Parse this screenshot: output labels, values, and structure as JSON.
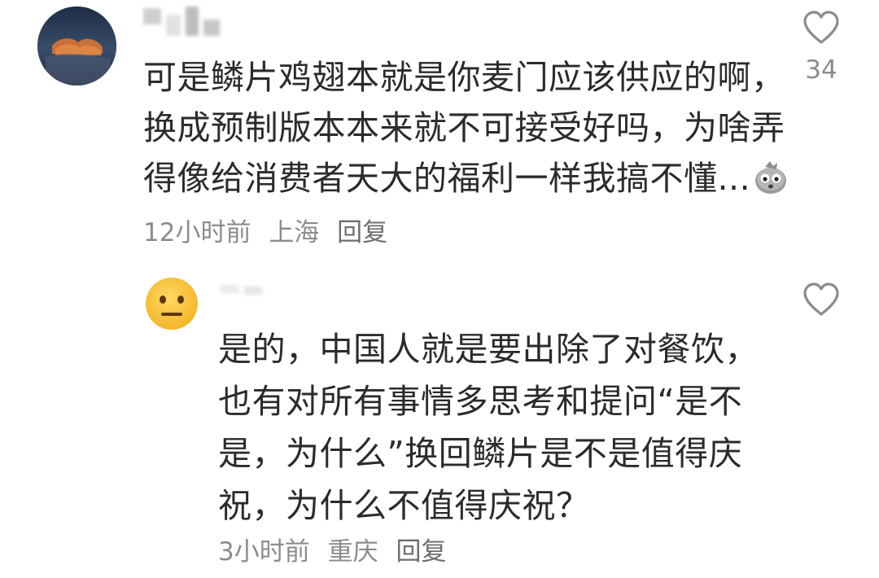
{
  "comment": {
    "text_lines": [
      "可是鳞片鸡翅本就是你麦门应该供应的啊，",
      "换成预制版本本来就不可接受好吗，为啥弄",
      "得像给消费者天大的福利一样我搞不懂..."
    ],
    "time": "12小时前",
    "location": "上海",
    "reply_label": "回复",
    "like_count": "34",
    "trailing_emoji": "stone-face-emoji"
  },
  "reply": {
    "text_lines": [
      "是的，中国人就是要出除了对餐饮，",
      "也有对所有事情多思考和提问“是不",
      "是，为什么”换回鳞片是不是值得庆",
      "祝，为什么不值得庆祝？"
    ],
    "time": "3小时前",
    "location": "重庆",
    "reply_label": "回复",
    "avatar_emoji": "neutral-face-emoji"
  },
  "colors": {
    "text": "#2b2b2b",
    "meta": "#8c8c8c",
    "icon": "#8c8c8c"
  }
}
